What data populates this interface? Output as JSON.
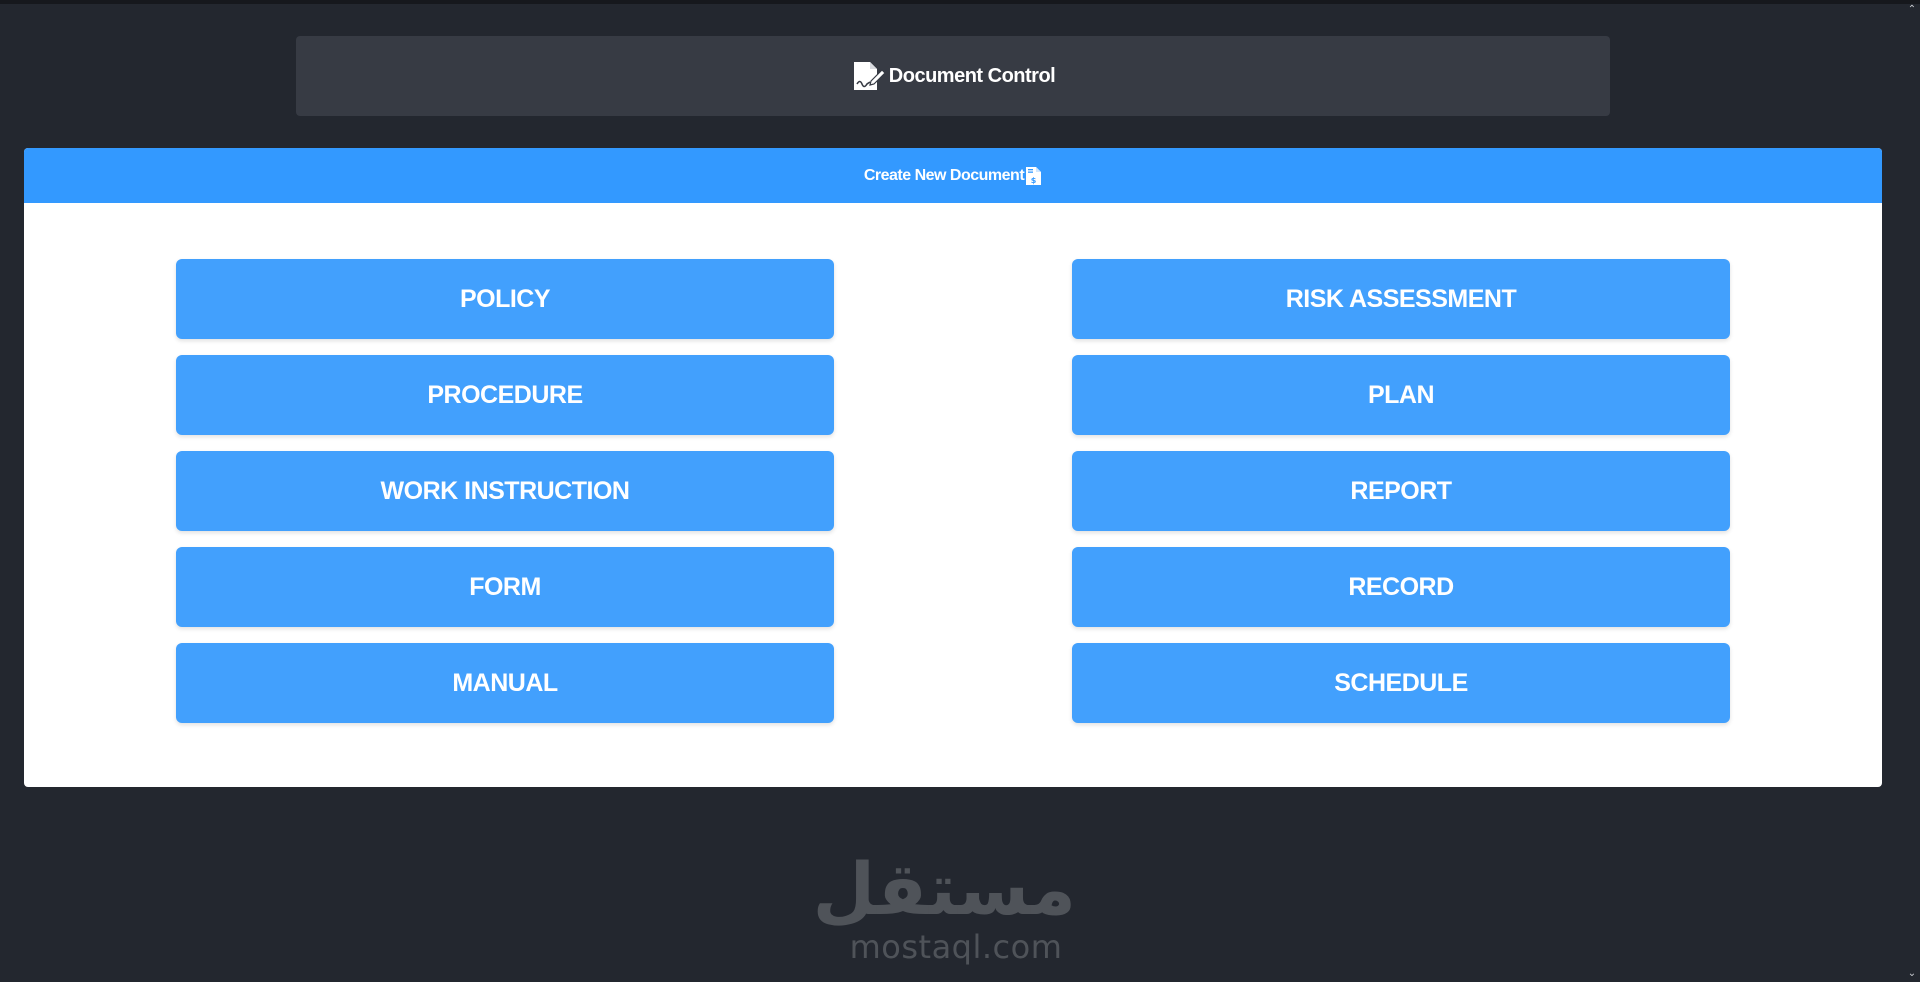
{
  "header": {
    "title": "Document Control",
    "icon": "file-signature-icon"
  },
  "card": {
    "title": "Create New Document",
    "icon": "file-invoice-dollar-icon"
  },
  "document_types": {
    "left": [
      "POLICY",
      "PROCEDURE",
      "WORK INSTRUCTION",
      "FORM",
      "MANUAL"
    ],
    "right": [
      "RISK ASSESSMENT",
      "PLAN",
      "REPORT",
      "RECORD",
      "SCHEDULE"
    ]
  },
  "watermark": {
    "arabic": "مستقل",
    "latin": "mostaql.com"
  },
  "colors": {
    "background": "#23272f",
    "header_bg": "#373b44",
    "card_header_bg": "#3399ff",
    "button_bg": "#42a0fd",
    "text": "#ffffff"
  }
}
